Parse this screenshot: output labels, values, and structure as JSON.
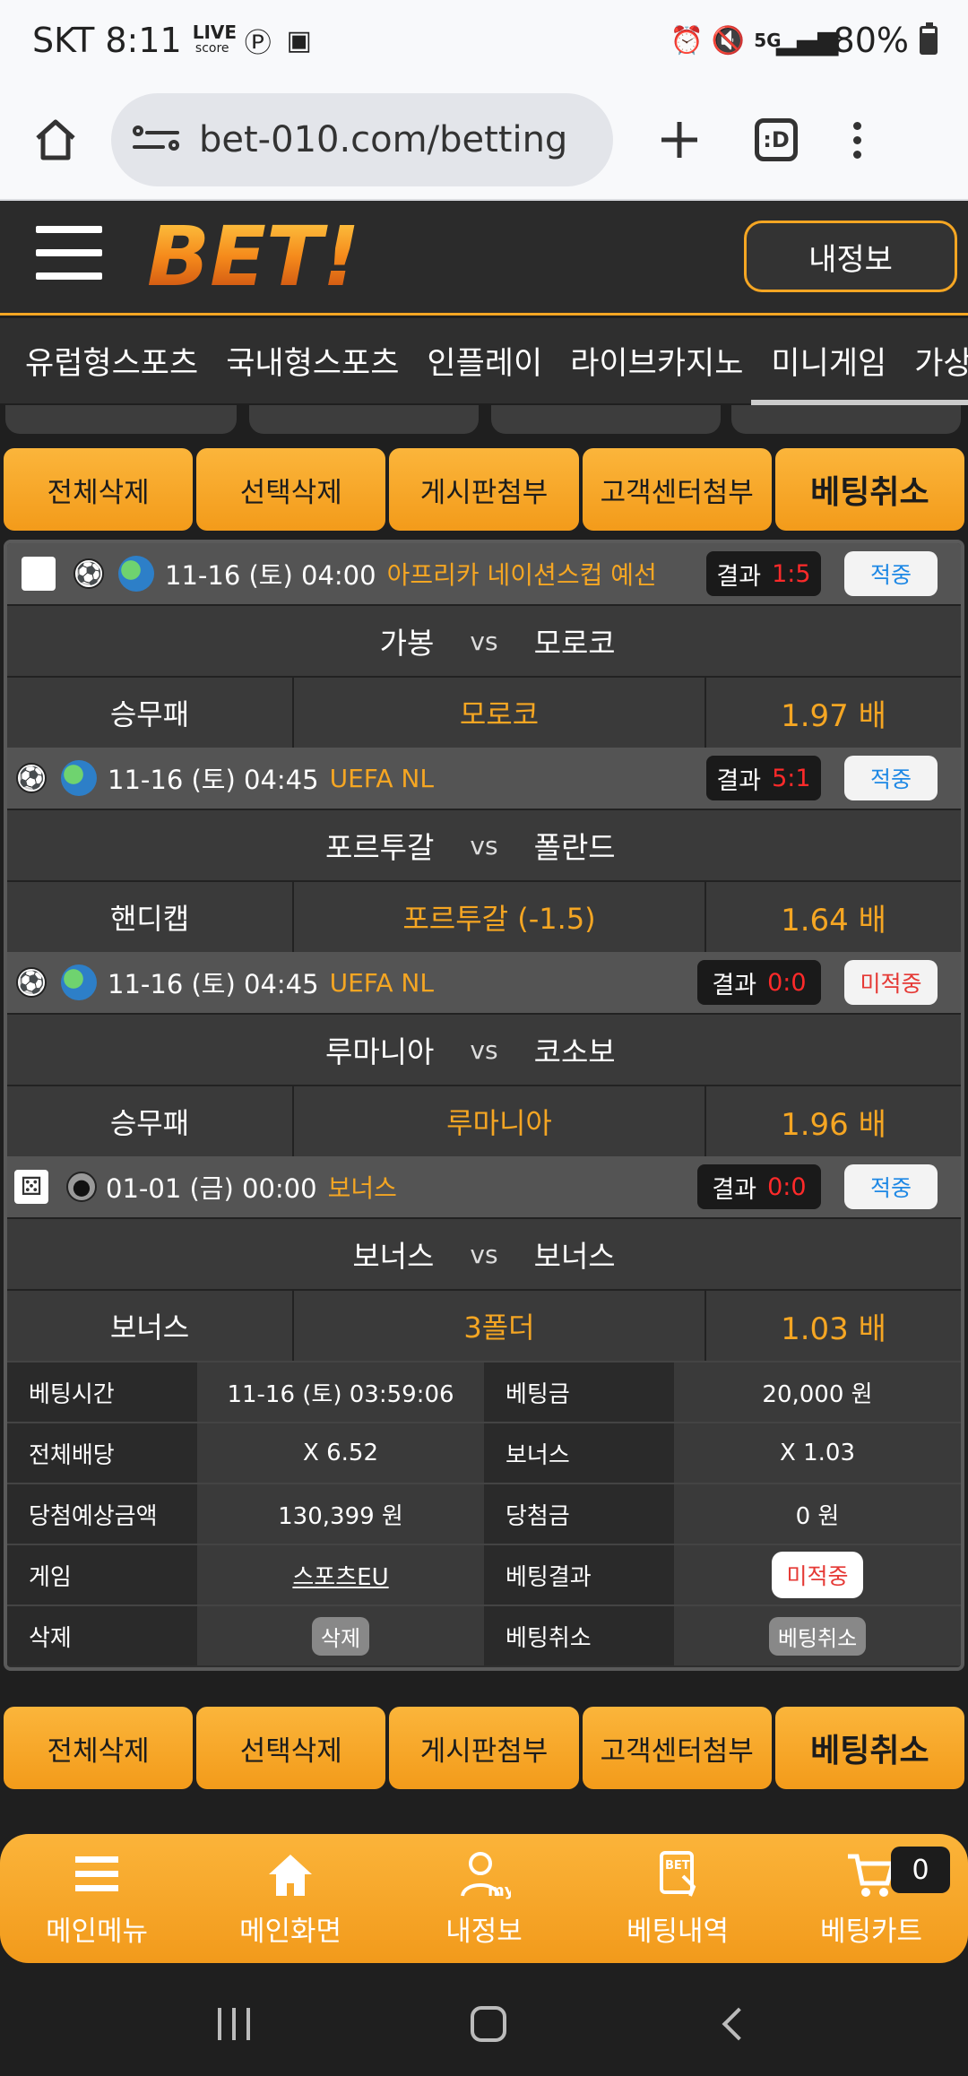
{
  "status_bar": {
    "carrier_time": "SKT 8:11",
    "live_label": "LIVE",
    "live_sub": "score",
    "battery": "80%",
    "network": "5G"
  },
  "browser": {
    "url": "bet-010.com/betting",
    "tab_label": ":D"
  },
  "header": {
    "logo_text": "BET!",
    "myinfo_label": "내정보"
  },
  "categories": [
    "유럽형스포츠",
    "국내형스포츠",
    "인플레이",
    "라이브카지노",
    "미니게임",
    "가상게임"
  ],
  "actions": {
    "delete_all": "전체삭제",
    "delete_selected": "선택삭제",
    "attach_board": "게시판첨부",
    "attach_support": "고객센터첨부",
    "cancel_bet": "베팅취소"
  },
  "games": [
    {
      "time": "11-16 (토) 04:00",
      "league": "아프리카 네이션스컵 예선",
      "result_label": "결과",
      "score": "1:5",
      "status": "적중",
      "home": "가봉",
      "vs": "vs",
      "away": "모로코",
      "bet_type": "승무패",
      "pick": "모로코",
      "odds": "1.97 배"
    },
    {
      "time": "11-16 (토) 04:45",
      "league": "UEFA NL",
      "result_label": "결과",
      "score": "5:1",
      "status": "적중",
      "home": "포르투갈",
      "vs": "vs",
      "away": "폴란드",
      "bet_type": "핸디캡",
      "pick": "포르투갈 (-1.5)",
      "odds": "1.64 배"
    },
    {
      "time": "11-16 (토) 04:45",
      "league": "UEFA NL",
      "result_label": "결과",
      "score": "0:0",
      "status": "미적중",
      "home": "루마니아",
      "vs": "vs",
      "away": "코소보",
      "bet_type": "승무패",
      "pick": "루마니아",
      "odds": "1.96 배"
    },
    {
      "time": "01-01 (금) 00:00",
      "league": "보너스",
      "result_label": "결과",
      "score": "0:0",
      "status": "적중",
      "home": "보너스",
      "vs": "vs",
      "away": "보너스",
      "bet_type": "보너스",
      "pick": "3폴더",
      "odds": "1.03 배"
    }
  ],
  "summary": {
    "bet_time_label": "베팅시간",
    "bet_time": "11-16 (토) 03:59:06",
    "bet_amount_label": "베팅금",
    "bet_amount": "20,000 원",
    "total_odds_label": "전체배당",
    "total_odds": "X 6.52",
    "bonus_label": "보너스",
    "bonus": "X 1.03",
    "expected_label": "당첨예상금액",
    "expected": "130,399 원",
    "win_label": "당첨금",
    "win": "0 원",
    "game_label": "게임",
    "game": "스포츠EU",
    "result_label": "베팅결과",
    "result": "미적중",
    "delete_label": "삭제",
    "delete_btn": "삭제",
    "cancel_label": "베팅취소",
    "cancel_btn": "베팅취소"
  },
  "bottom_nav": {
    "main_menu": "메인메뉴",
    "home": "메인화면",
    "myinfo": "내정보",
    "history": "베팅내역",
    "cart": "베팅카트",
    "cart_count": "0",
    "myinfo_icon_text": "my",
    "history_icon_text": "BET"
  },
  "colors": {
    "accent": "#f5a623",
    "hit": "#1e88e5",
    "miss": "#e53935",
    "score": "#ff2a2a"
  }
}
